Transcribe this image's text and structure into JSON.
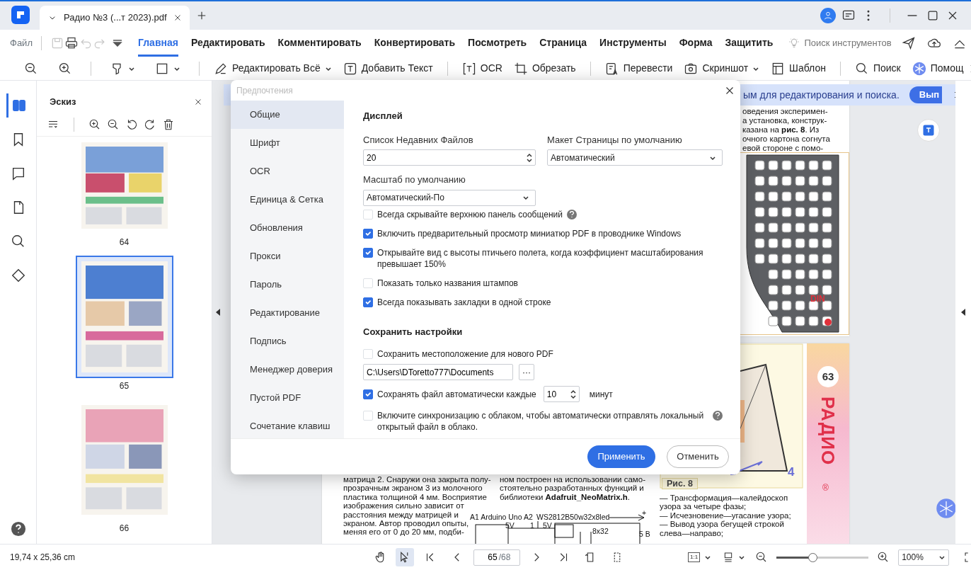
{
  "window": {
    "tab_title": "Радио №3 (...т 2023).pdf"
  },
  "menu": {
    "file": "Файл",
    "quick_actions": [
      {
        "disabled": true
      },
      {
        "disabled": false
      },
      {
        "disabled": true
      },
      {
        "disabled": true
      }
    ],
    "tabs": [
      {
        "label": "Главная",
        "selected": true
      },
      {
        "label": "Редактировать",
        "selected": false
      },
      {
        "label": "Комментировать",
        "selected": false
      },
      {
        "label": "Конвертировать",
        "selected": false
      },
      {
        "label": "Посмотреть",
        "selected": false
      },
      {
        "label": "Страница",
        "selected": false
      },
      {
        "label": "Инструменты",
        "selected": false
      },
      {
        "label": "Форма",
        "selected": false
      },
      {
        "label": "Защитить",
        "selected": false
      }
    ],
    "search": {
      "placeholder": "Поиск инструментов"
    }
  },
  "toolbar": {
    "groups": [
      [
        {
          "dropdown": false
        },
        {
          "dropdown": false
        }
      ],
      [
        {
          "dropdown": true
        },
        {
          "dropdown": true
        }
      ],
      [
        {
          "label": "Редактировать Всё",
          "dropdown": true
        },
        {
          "label": "Добавить Текст",
          "dropdown": false
        }
      ],
      [
        {
          "label": "OCR",
          "dropdown": false
        },
        {
          "label": "Обрезать",
          "dropdown": false
        }
      ],
      [
        {
          "label": "Перевести",
          "dropdown": false
        },
        {
          "label": "Скриншот",
          "dropdown": true
        },
        {
          "label": "Шаблон",
          "dropdown": false
        }
      ],
      [
        {
          "label": "Поиск",
          "dropdown": false
        },
        {
          "label": "Помощ",
          "dropdown": false
        }
      ]
    ]
  },
  "sidebar": {
    "items": [
      {
        "selected": true
      },
      {
        "selected": false
      },
      {
        "selected": false
      },
      {
        "selected": false
      },
      {
        "selected": false
      },
      {
        "selected": false
      }
    ]
  },
  "thumbnails": {
    "title": "Эскиз",
    "pages": [
      {
        "number": "64",
        "selected": false
      },
      {
        "number": "65",
        "selected": true
      },
      {
        "number": "66",
        "selected": false
      }
    ]
  },
  "document": {
    "banner": {
      "text": "ым для редактирования и поиска.",
      "button": "Вып"
    },
    "top_page": {
      "lines": [
        "оведения эксперимен-",
        "а установка, конструк-",
        "казана на **рис. 8**. Из",
        "очного картона согнута",
        "евой стороне с помо-"
      ],
      "figure_label": "DIN"
    },
    "bottom_page": {
      "col1": [
        "матрица 2. Снаружи она закрыта полу-",
        "прозрачным экраном 3 из молочного",
        "пластика толщиной 4 мм. Восприятие",
        "изображения сильно зависит от",
        "расстояния между матрицей и",
        "экраном. Автор проводил опыты,",
        "меняя его от 0 до 20 мм, подби-"
      ],
      "col2": [
        "ном построен на использовании само-",
        "стоятельно разработанных функций и",
        "библиотеки **Adafruit_NeoMatrix.h**."
      ],
      "schematic": [
        "A1 Arduino Uno",
        "A2",
        "WS2812B50w32x8led",
        "+",
        "5V",
        "1",
        "5V",
        "8x32",
        "5 В"
      ],
      "figure_caption": "Рис. 8",
      "figure_number": "4",
      "col3": [
        "— Трансформация—калейдоскоп",
        "узора за четыре фазы;",
        "— Исчезновение—угасание узора;",
        "— Вывод узора бегущей строкой",
        "слева—направо;"
      ],
      "page_number": "63",
      "brand": "РАДИО",
      "registered": "®"
    }
  },
  "dialog": {
    "title": "Предпочтения",
    "nav": [
      {
        "label": "Общие",
        "selected": true
      },
      {
        "label": "Шрифт",
        "selected": false
      },
      {
        "label": "OCR",
        "selected": false
      },
      {
        "label": "Единица & Сетка",
        "selected": false
      },
      {
        "label": "Обновления",
        "selected": false
      },
      {
        "label": "Прокси",
        "selected": false
      },
      {
        "label": "Пароль",
        "selected": false
      },
      {
        "label": "Редактирование",
        "selected": false
      },
      {
        "label": "Подпись",
        "selected": false
      },
      {
        "label": "Менеджер доверия",
        "selected": false
      },
      {
        "label": "Пустой PDF",
        "selected": false
      },
      {
        "label": "Сочетание клавиш",
        "selected": false
      }
    ],
    "display": {
      "heading": "Дисплей",
      "recent_files": {
        "label": "Список Недавних Файлов",
        "value": "20"
      },
      "page_layout": {
        "label": "Макет Страницы по умолчанию",
        "value": "Автоматический"
      },
      "zoom": {
        "label": "Масштаб по умолчанию",
        "value": "Автоматический-По"
      },
      "options": [
        {
          "label": "Всегда скрывайте верхнюю панель сообщений",
          "checked": false,
          "help": true
        },
        {
          "label": "Включить предварительный просмотр миниатюр PDF в проводнике Windows",
          "checked": true,
          "help": false
        },
        {
          "label": "Открывайте вид с высоты птичьего полета, когда коэффициент масштабирования превышает 150%",
          "checked": true,
          "help": false
        },
        {
          "label": "Показать только названия штампов",
          "checked": false,
          "help": false
        },
        {
          "label": "Всегда показывать закладки в одной строке",
          "checked": true,
          "help": false
        }
      ]
    },
    "save": {
      "heading": "Сохранить настройки",
      "location": {
        "label": "Сохранить местоположение для нового PDF",
        "checked": false
      },
      "path": {
        "value": "C:\\Users\\DToretto777\\Documents",
        "browse": "···"
      },
      "autosave": {
        "label": "Сохранять файл автоматически каждые",
        "checked": true,
        "value": "10",
        "unit": "минут"
      },
      "cloud": {
        "label": "Включите синхронизацию с облаком, чтобы автоматически отправлять локальный открытый файл в облако.",
        "checked": false,
        "help": true
      }
    },
    "buttons": {
      "apply": "Применить",
      "cancel": "Отменить"
    }
  },
  "status": {
    "page_size": "19,74 x 25,36 cm",
    "tools": [
      {
        "selected": false
      },
      {
        "selected": true
      }
    ],
    "page": {
      "current": "65",
      "total": "/68"
    },
    "fit_label": "1:1",
    "zoom": {
      "level": 0.39,
      "value": "100%"
    }
  }
}
